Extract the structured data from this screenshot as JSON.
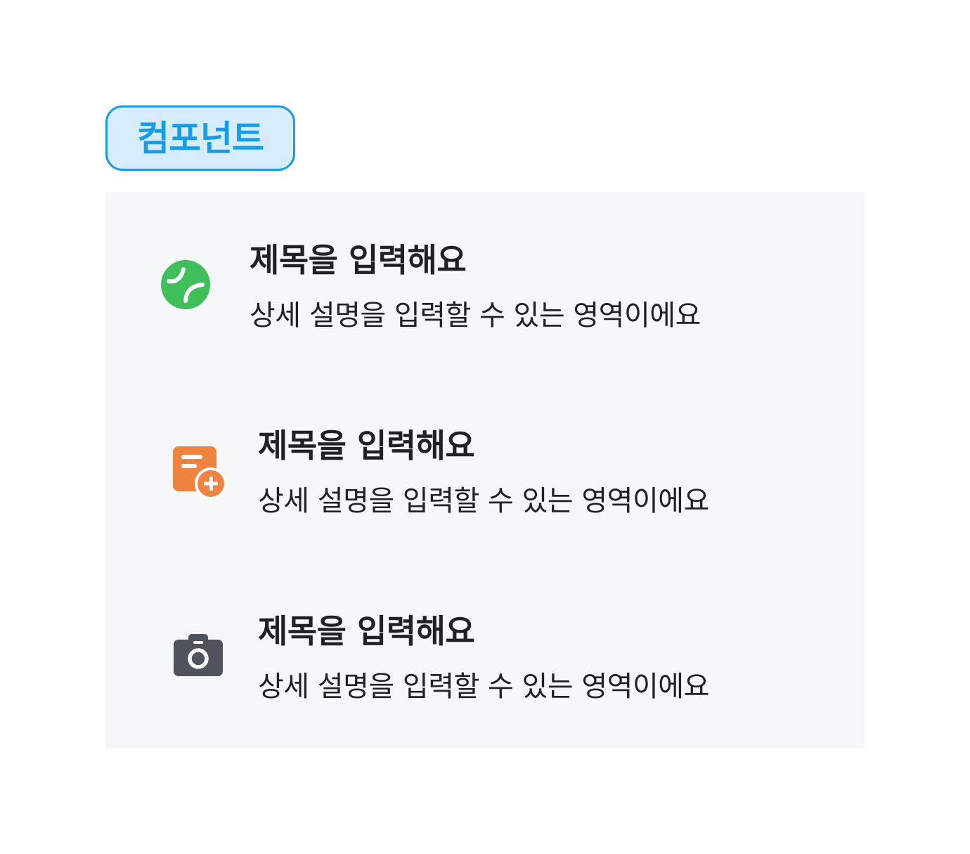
{
  "badge": {
    "label": "컴포넌트",
    "border_color": "#1a9be6",
    "background_color": "#d6ecf9"
  },
  "list": {
    "background_color": "#f6f7f9",
    "items": [
      {
        "icon": "tennis-ball-icon",
        "icon_color": "#3fbf5a",
        "title": "제목을 입력해요",
        "description": "상세 설명을 입력할 수 있는 영역이에요"
      },
      {
        "icon": "document-add-icon",
        "icon_color": "#ef8340",
        "title": "제목을 입력해요",
        "description": "상세 설명을 입력할 수 있는 영역이에요"
      },
      {
        "icon": "camera-icon",
        "icon_color": "#4e535c",
        "title": "제목을 입력해요",
        "description": "상세 설명을 입력할 수 있는 영역이에요"
      }
    ]
  }
}
